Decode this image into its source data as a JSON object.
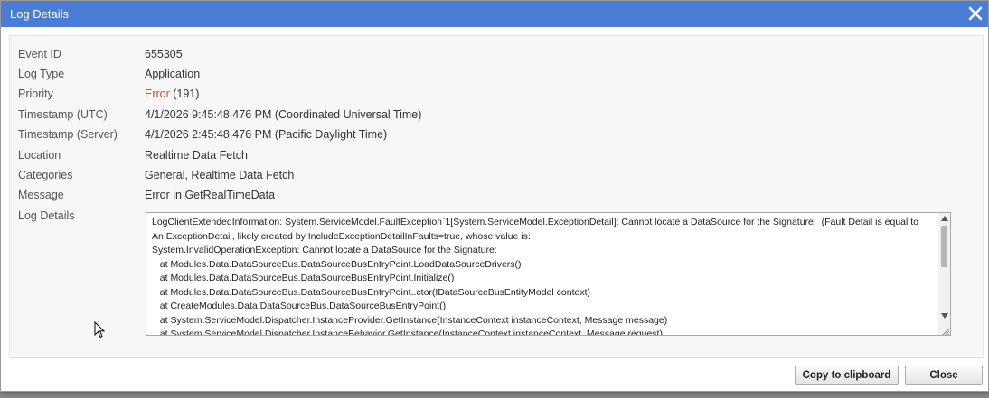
{
  "dialog": {
    "title": "Log Details",
    "close_icon": "close-x-icon"
  },
  "fields": [
    {
      "label": "Event ID",
      "value": "655305"
    },
    {
      "label": "Log Type",
      "value": "Application"
    },
    {
      "label": "Priority",
      "value_error": "Error",
      "value_rest": " (191)"
    },
    {
      "label": "Timestamp (UTC)",
      "value": "4/1/2026 9:45:48.476 PM (Coordinated Universal Time)"
    },
    {
      "label": "Timestamp (Server)",
      "value": "4/1/2026 2:45:48.476 PM (Pacific Daylight Time)"
    },
    {
      "label": "Location",
      "value": "Realtime Data Fetch"
    },
    {
      "label": "Categories",
      "value": "General, Realtime Data Fetch"
    },
    {
      "label": "Message",
      "value": "Error in GetRealTimeData"
    },
    {
      "label": "Log Details"
    }
  ],
  "log_details_text": "LogClientExtendedInformation: System.ServiceModel.FaultException`1[System.ServiceModel.ExceptionDetail]: Cannot locate a DataSource for the Signature:  (Fault Detail is equal to An ExceptionDetail, likely created by IncludeExceptionDetailInFaults=true, whose value is:\nSystem.InvalidOperationException: Cannot locate a DataSource for the Signature:\n   at Modules.Data.DataSourceBus.DataSourceBusEntryPoint.LoadDataSourceDrivers()\n   at Modules.Data.DataSourceBus.DataSourceBusEntryPoint.Initialize()\n   at Modules.Data.DataSourceBus.DataSourceBusEntryPoint..ctor(IDataSourceBusEntityModel context)\n   at CreateModules.Data.DataSourceBus.DataSourceBusEntryPoint()\n   at System.ServiceModel.Dispatcher.InstanceProvider.GetInstance(InstanceContext instanceContext, Message message)\n   at System.ServiceModel.Dispatcher.InstanceBehavior.GetInstance(InstanceContext instanceContext, Message request)",
  "buttons": {
    "copy_label": "Copy to clipboard",
    "close_label": "Close"
  },
  "colors": {
    "titlebar": "#4a7ed6",
    "error": "#c8541c"
  }
}
